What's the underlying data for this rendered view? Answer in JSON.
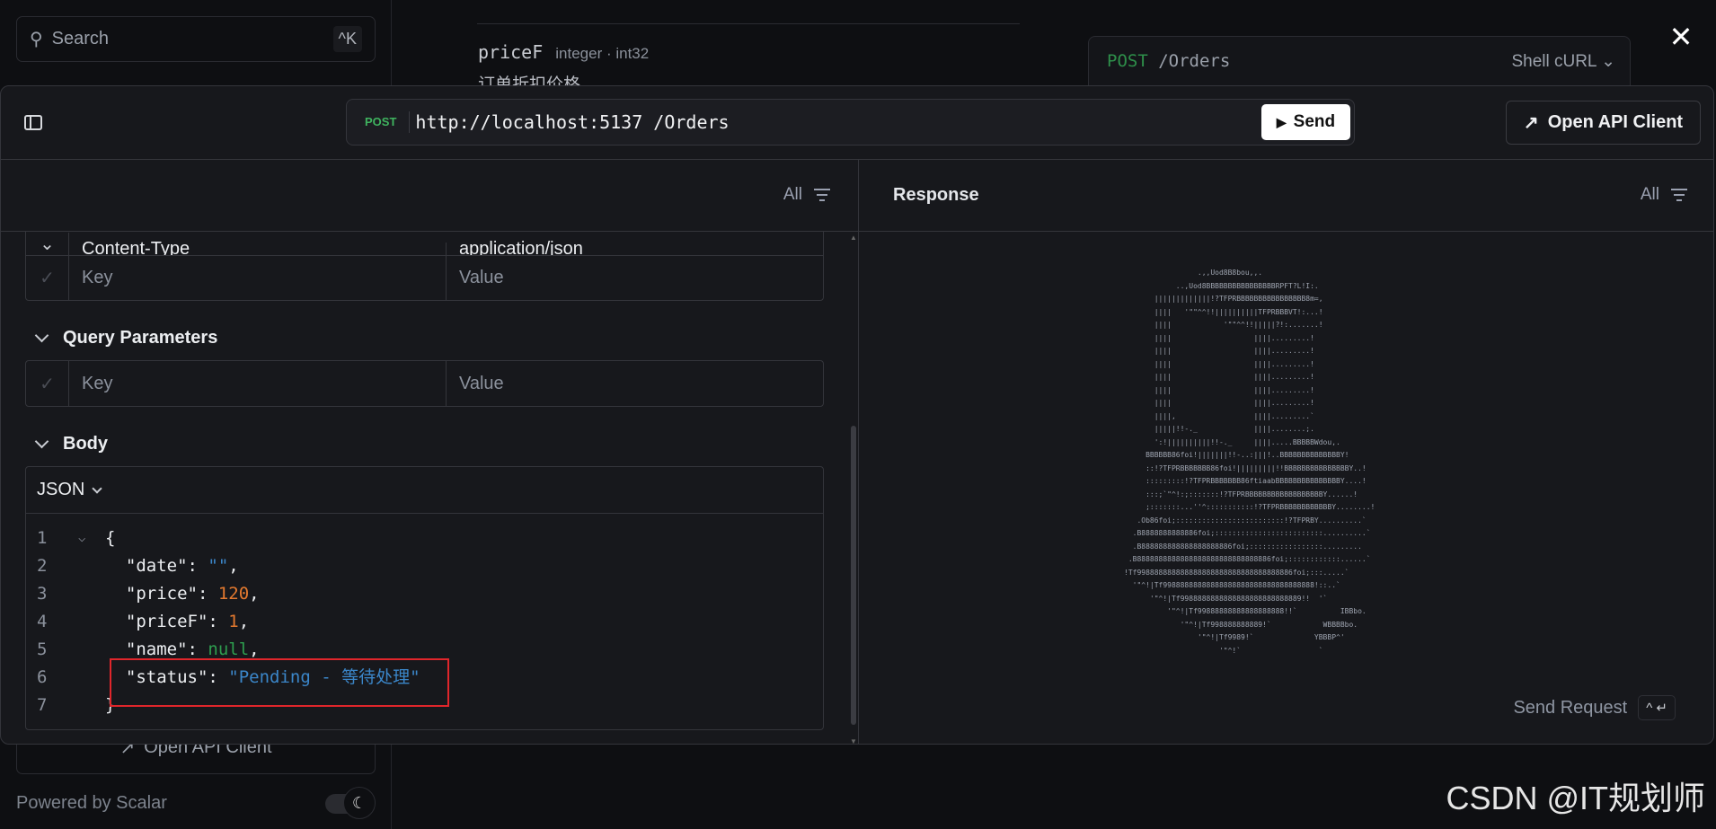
{
  "sidebar": {
    "search_placeholder": "Search",
    "search_shortcut": "^K",
    "open_client": "Open API Client",
    "powered_by": "Powered by Scalar"
  },
  "docs": {
    "field_name": "priceF",
    "field_type": "integer · int32",
    "field_desc": "订单折扣价格",
    "code_method": "POST",
    "code_path": "/Orders",
    "code_lang": "Shell cURL"
  },
  "modal": {
    "method": "POST",
    "url": "http://localhost:5137 /Orders",
    "send": "Send",
    "open_client": "Open API Client",
    "filter_label": "All",
    "headers": {
      "partial_key": "Content-Type",
      "partial_value": "application/json",
      "key_placeholder": "Key",
      "value_placeholder": "Value"
    },
    "query": {
      "title": "Query Parameters",
      "key_placeholder": "Key",
      "value_placeholder": "Value"
    },
    "body": {
      "title": "Body",
      "format": "JSON",
      "lines": [
        {
          "n": "1",
          "fold": true,
          "parts": [
            {
              "t": "{",
              "c": "p"
            }
          ]
        },
        {
          "n": "2",
          "parts": [
            {
              "t": "  \"date\"",
              "c": "k"
            },
            {
              "t": ": ",
              "c": "p"
            },
            {
              "t": "\"\"",
              "c": "vs"
            },
            {
              "t": ",",
              "c": "p"
            }
          ]
        },
        {
          "n": "3",
          "parts": [
            {
              "t": "  \"price\"",
              "c": "k"
            },
            {
              "t": ": ",
              "c": "p"
            },
            {
              "t": "120",
              "c": "vn"
            },
            {
              "t": ",",
              "c": "p"
            }
          ]
        },
        {
          "n": "4",
          "parts": [
            {
              "t": "  \"priceF\"",
              "c": "k"
            },
            {
              "t": ": ",
              "c": "p"
            },
            {
              "t": "1",
              "c": "vn"
            },
            {
              "t": ",",
              "c": "p"
            }
          ]
        },
        {
          "n": "5",
          "parts": [
            {
              "t": "  \"name\"",
              "c": "k"
            },
            {
              "t": ": ",
              "c": "p"
            },
            {
              "t": "null",
              "c": "vnull"
            },
            {
              "t": ",",
              "c": "p"
            }
          ]
        },
        {
          "n": "6",
          "parts": [
            {
              "t": "  \"status\"",
              "c": "k"
            },
            {
              "t": ": ",
              "c": "p"
            },
            {
              "t": "\"Pending - 等待处理\"",
              "c": "vs"
            }
          ]
        },
        {
          "n": "7",
          "parts": [
            {
              "t": "}",
              "c": "p"
            }
          ]
        }
      ]
    },
    "response": {
      "title": "Response",
      "filter_label": "All",
      "send_request": "Send Request",
      "shortcut": "^ ↵",
      "ascii_logo": [
        "                 .,,Uod8B8bou,,.",
        "            ..,Uod8BBBBBBBBBBBBBBBBRPFT?L!I:.",
        "       |||||||||||||!?TFPRBBBBBBBBBBBBBBBB8m=,",
        "       ||||   '\"\"^^!!||||||||||TFPRBBBVT!:...!",
        "       ||||            '\"\"^^!!|||||?!:.......!",
        "       ||||                   ||||.........!",
        "       ||||                   ||||.........!",
        "       ||||                   ||||.........!",
        "       ||||                   ||||.........!",
        "       ||||                   ||||.........!",
        "       ||||                   ||||.........!",
        "       ||||,                  ||||.........`",
        "       |||||!!-._             ||||........;.",
        "       ':!||||||||||!!-._     ||||.....BBBBBWdou,.",
        "     BBBBBB86foi!|||||||!!-..:|||!..BBBBBBBBBBBBBBY!",
        "     ::!?TFPRBBBBBBB86foi!|||||||||!!BBBBBBBBBBBBBBBY..!",
        "     :::::::::!?TFPRBBBBBBB86ftiaabBBBBBBBBBBBBBBBY....!",
        "     :::;`\"^!:;:::::::!?TFPRBBBBBBBBBBBBBBBBBBY......!",
        "     ;:::::::...''^:::::::::::!?TFPRBBBBBBBBBBBBY........!",
        "   .Ob86foi;:::::::::::::::::::::::::!?TFPRBY..........`",
        "  .B8888888888886foi;:::::::::::::::::::::::::..........`",
        "  .B888888888888888888886foi;:::::::::::::::::.........",
        " .B8888888888888888888888888888886foi;::::::::::::......`",
        "!Tf998888888888888888888888888888888886foi;:::.....`",
        "  '\"^!|Tf99888888888888888888888888888888888!::..`",
        "      '\"^!|Tf9988888888888888888888888889!!  '`",
        "          '\"^!|Tf99888888888888888888!!`          IBBbo.",
        "             '\"^!|Tf998888888889!`            WBBBBbo.",
        "                 '\"^!|Tf9989!`              YBBBP^'",
        "                      '\"^!`                  `"
      ]
    }
  },
  "watermark": "CSDN @IT规划师",
  "colors": {
    "method_post": "#3fb35f",
    "string": "#3b86c9",
    "number": "#e3792f",
    "null": "#2e9e4f",
    "highlight_box": "#e0262b"
  }
}
